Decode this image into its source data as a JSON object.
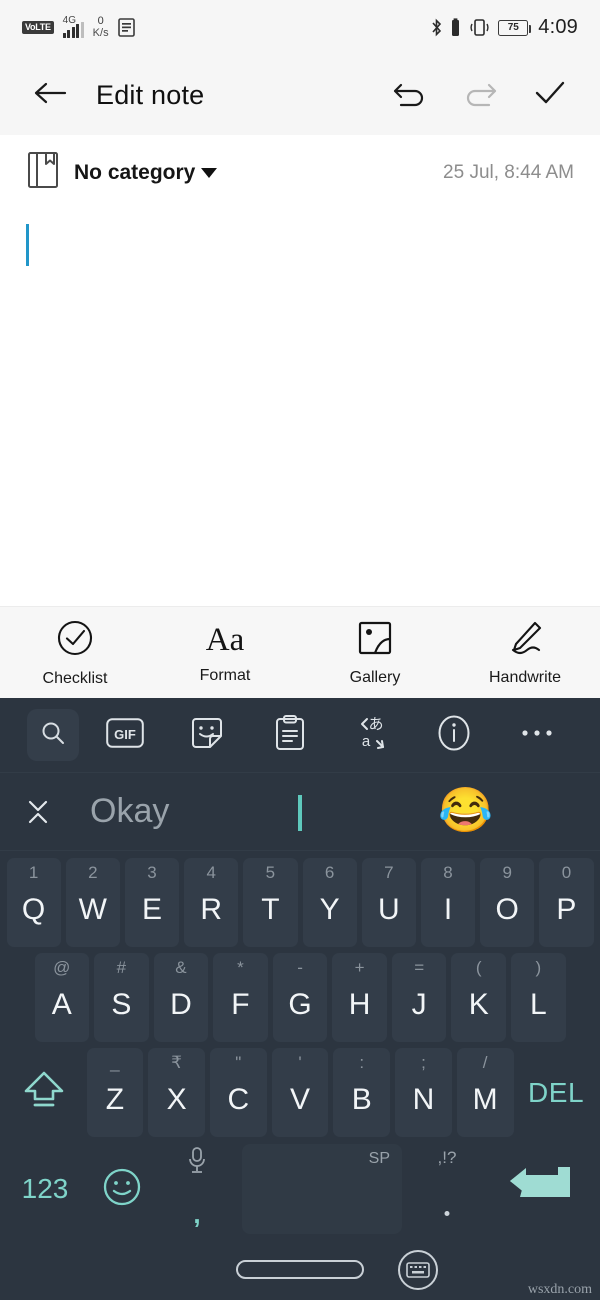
{
  "status_bar": {
    "volte_badge": "VoLTE",
    "network_gen": "4G",
    "data_rate_value": "0",
    "data_rate_unit": "K/s",
    "sim_icon": "sim-card-icon",
    "bluetooth_icon": "bluetooth-icon",
    "vibrate_icon": "vibrate-icon",
    "battery_percent": "75",
    "clock": "4:09"
  },
  "app_bar": {
    "back_icon": "arrow-left-icon",
    "title": "Edit note",
    "undo_icon": "undo-icon",
    "redo_icon": "redo-icon",
    "done_icon": "check-icon"
  },
  "meta_row": {
    "category_icon": "notebook-icon",
    "category_label": "No category",
    "dropdown_icon": "caret-down-icon",
    "timestamp": "25 Jul, 8:44 AM"
  },
  "note_body": {
    "text": "",
    "cursor_color": "#2196c9"
  },
  "note_toolbar": [
    {
      "icon": "check-circle-icon",
      "label": "Checklist"
    },
    {
      "icon": "format-aa-icon",
      "label": "Format"
    },
    {
      "icon": "gallery-image-icon",
      "label": "Gallery"
    },
    {
      "icon": "handwrite-pen-icon",
      "label": "Handwrite"
    }
  ],
  "keyboard": {
    "theme_bg": "#2c3540",
    "key_bg": "#333d49",
    "accent": "#7fd4c9",
    "toolbar": [
      {
        "icon": "search-icon",
        "active": true
      },
      {
        "icon": "gif-icon",
        "label": "GIF"
      },
      {
        "icon": "sticker-icon"
      },
      {
        "icon": "clipboard-icon"
      },
      {
        "icon": "translate-icon"
      },
      {
        "icon": "info-icon"
      },
      {
        "icon": "more-horizontal-icon"
      }
    ],
    "suggestion_bar": {
      "collapse_icon": "collapse-chevrons-icon",
      "suggestion": "Okay",
      "caret_color": "#5ec8bc",
      "emoji": "😂"
    },
    "row1": [
      {
        "alt": "1",
        "main": "Q"
      },
      {
        "alt": "2",
        "main": "W"
      },
      {
        "alt": "3",
        "main": "E"
      },
      {
        "alt": "4",
        "main": "R"
      },
      {
        "alt": "5",
        "main": "T"
      },
      {
        "alt": "6",
        "main": "Y"
      },
      {
        "alt": "7",
        "main": "U"
      },
      {
        "alt": "8",
        "main": "I"
      },
      {
        "alt": "9",
        "main": "O"
      },
      {
        "alt": "0",
        "main": "P"
      }
    ],
    "row2": [
      {
        "alt": "@",
        "main": "A"
      },
      {
        "alt": "#",
        "main": "S"
      },
      {
        "alt": "&",
        "main": "D"
      },
      {
        "alt": "*",
        "main": "F"
      },
      {
        "alt": "-",
        "main": "G"
      },
      {
        "alt": "+",
        "main": "H"
      },
      {
        "alt": "=",
        "main": "J"
      },
      {
        "alt": "(",
        "main": "K"
      },
      {
        "alt": ")",
        "main": "L"
      }
    ],
    "row3": {
      "shift_icon": "shift-up-icon",
      "keys": [
        {
          "alt": "_",
          "main": "Z"
        },
        {
          "alt": "₹",
          "main": "X"
        },
        {
          "alt": "\"",
          "main": "C"
        },
        {
          "alt": "'",
          "main": "V"
        },
        {
          "alt": ":",
          "main": "B"
        },
        {
          "alt": ";",
          "main": "N"
        },
        {
          "alt": "/",
          "main": "M"
        }
      ],
      "delete_label": "DEL"
    },
    "row4": {
      "numeric_label": "123",
      "emoji_icon": "emoji-smiley-icon",
      "mic_icon": "microphone-icon",
      "comma_label": ",",
      "space_label": "SP",
      "punct_label": ",!?",
      "period_label": ".",
      "enter_icon": "enter-arrow-icon"
    }
  },
  "nav_bar": {
    "home_indicator": "home-pill-indicator",
    "hide_keyboard_icon": "hide-keyboard-icon",
    "watermark": "wsxdn.com"
  }
}
